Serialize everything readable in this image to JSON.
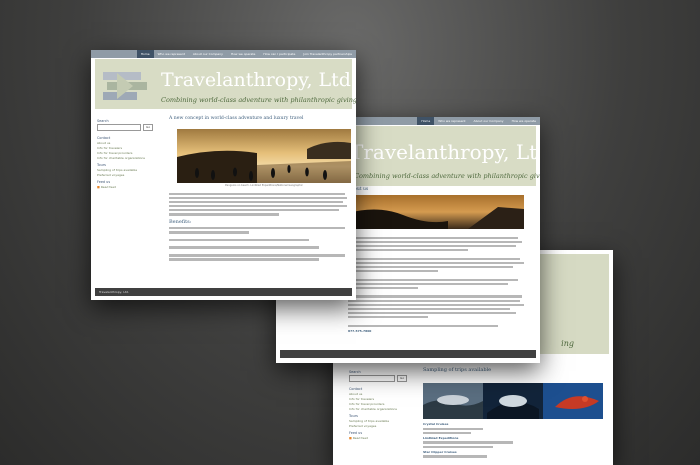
{
  "nav": {
    "tabs": [
      "Home",
      "Who we represent",
      "About our Company",
      "How we operate",
      "How can I participate",
      "Join Travelanthropy partnerships"
    ]
  },
  "site": {
    "title": "Travelanthropy, Ltd.",
    "tagline": "Combining world-class adventure with philanthropic giving"
  },
  "sidebar": {
    "search_label": "Search",
    "go_label": "Go",
    "contact_heading": "Contact",
    "contact_links": [
      "About us",
      "Info for travelers",
      "Info for travel providers",
      "Info for charitable organizations"
    ],
    "tours_heading": "Tours",
    "tours_links": [
      "Sampling of trips available",
      "Preferred voyages"
    ],
    "feeds_heading": "Feed us",
    "feeds_link": "Read feed"
  },
  "win1": {
    "heading": "A new concept in world-class adventure and luxury travel",
    "caption": "Penguins on beach. Lindblad Expeditions/National Geographic",
    "benefits_heading": "Benefits:",
    "footer": "Travelanthropy, Ltd."
  },
  "win2": {
    "heading": "About us",
    "phone": "877-575-7800"
  },
  "win3": {
    "heading": "Sampling of trips available",
    "trip_groups": [
      "Crystal Cruises",
      "Lindblad Expeditions",
      "Star Clipper Cruises"
    ]
  }
}
